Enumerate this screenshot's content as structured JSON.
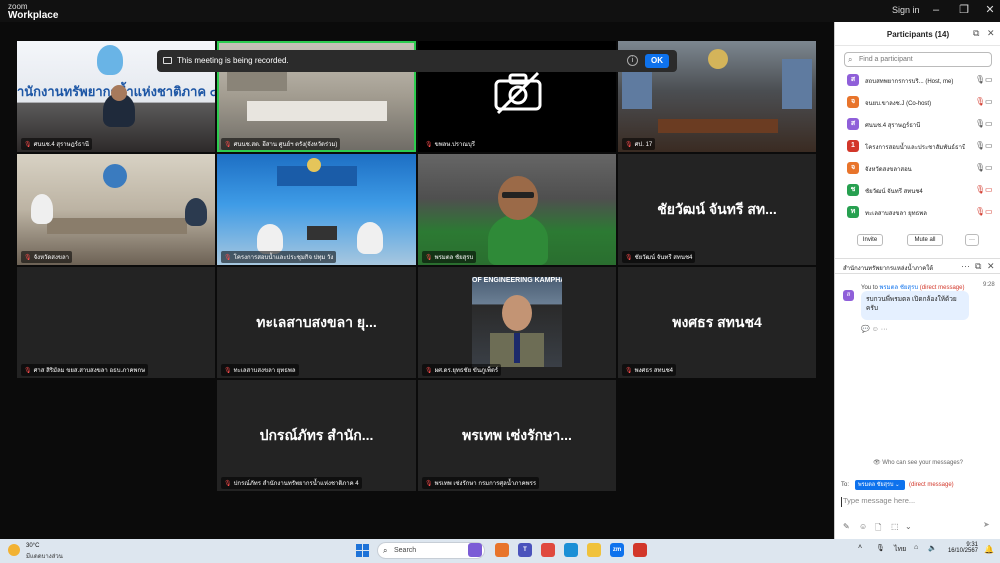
{
  "app": {
    "logo_line1": "zoom",
    "logo_line2": "Workplace",
    "signin": "Sign in"
  },
  "recording_banner": {
    "text": "This meeting is being recorded.",
    "ok": "OK"
  },
  "tiles": [
    {
      "name": "ศนนช.4 สุราษฎร์ธานี",
      "label": ""
    },
    {
      "name": "ศนนช.สต. อีสาน ศูนย์ฯ ตรัง(จังหวัดร่วม)",
      "label": ""
    },
    {
      "name": "ขพลษ.ปราณบุรี",
      "label": ""
    },
    {
      "name": "ศป. 17",
      "label": ""
    },
    {
      "name": "จังหวัดสงขลา",
      "label": ""
    },
    {
      "name": "โครงการสอบน้ำและประชุมกิจ ปทุม วัง",
      "label": ""
    },
    {
      "name": "พรมตล ชัยสุรบ",
      "label": ""
    },
    {
      "name": "ชัยวัฒน์ จันทรี สทนช4",
      "label": "ชัยวัฒน์ จันทรี สท..."
    },
    {
      "name": "ศาส สิริมัลม ขยส.สาบสงขลา อธบ.ภาคพกษ",
      "label": ""
    },
    {
      "name": "ทะเลสาบสงขลา ยุทธพล",
      "label": "ทะเลสาบสงขลา ยุ..."
    },
    {
      "name": "ผศ.ดร.ยุทธชัย ขันภูเพ็ตร์",
      "label": ""
    },
    {
      "name": "พงศธร สทนช4",
      "label": "พงศธร สทนช4"
    },
    {
      "name": "ปกรณ์ภัทร สำนักงานทรัพยากรน้ำแห่งชาติภาค 4",
      "label": "ปกรณ์ภัทร สำนัก..."
    },
    {
      "name": "พรเทพ เซ่งรักษา กรมการศุลน้ำภาคพรร",
      "label": "พรเทพ เซ่งรักษา..."
    }
  ],
  "participants": {
    "title": "Participants (14)",
    "find_placeholder": "Find a participant",
    "list": [
      {
        "initial": "ส",
        "color": "#8f5fd9",
        "name": "สถบสทพยากรการบริ... (Host, me)"
      },
      {
        "initial": "จ",
        "color": "#e8742b",
        "name": "จนยบ.ขาลงช.J (Co-host)"
      },
      {
        "initial": "ส",
        "color": "#8f5fd9",
        "name": "ศนนช.4 สุราษฎร์ธานี"
      },
      {
        "initial": "1",
        "color": "#d2372a",
        "name": "โครงการสอบน้ำและประชาสัมพันธ์ธานี"
      },
      {
        "initial": "จ",
        "color": "#e8742b",
        "name": "จังหวัดสงขลาสอน"
      },
      {
        "initial": "ช",
        "color": "#27a050",
        "name": "ชัยวัฒน์ จันทรี สทนช4"
      },
      {
        "initial": "ท",
        "color": "#27a050",
        "name": "ทะเลสาบสงขลา ยุทธพล"
      }
    ],
    "invite": "Invite",
    "mute_all": "Mute all",
    "more": "···"
  },
  "chat": {
    "title": "สำนักงานทรัพยากรแหล่งน้ำภาคใต้",
    "sender_you": "You to",
    "recipient": "พรมตล ชัยสุรบ",
    "direct": "(direct message)",
    "time": "9:28",
    "message": "รบกวนพี่พรมตล เปิดกล้องให้ด้วยครับ",
    "who_can_see": "Who can see your messages?",
    "to_label": "To:",
    "to_chip": "พรมตล ชัยสุรบ ⌄",
    "to_direct": "(direct message)",
    "type_placeholder": "Type message here..."
  },
  "taskbar": {
    "temp": "30°C",
    "weather_desc": "มีแดดบางส่วน",
    "search": "Search",
    "lang": "ไทย",
    "time": "9:31",
    "date": "16/10/2567"
  }
}
